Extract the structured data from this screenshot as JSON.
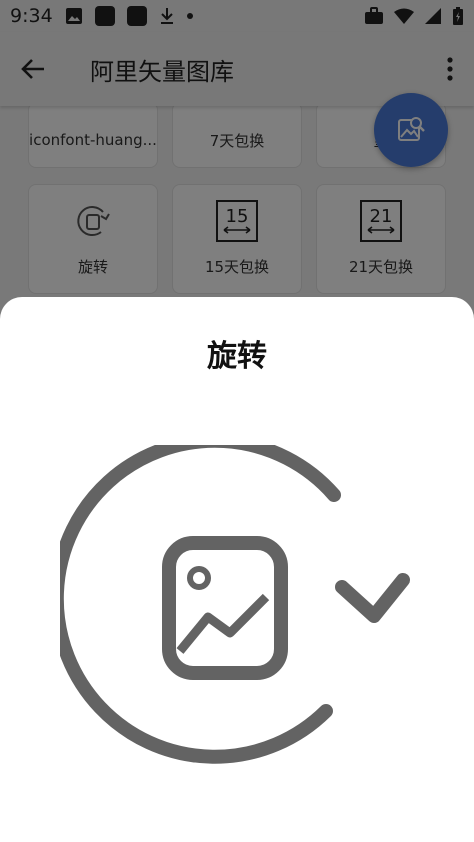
{
  "status_bar": {
    "time": "9:34",
    "icons": [
      "image-icon",
      "app-square-icon",
      "app-square-icon",
      "download-icon",
      "dot-icon",
      "briefcase-icon",
      "wifi-icon",
      "signal-icon",
      "battery-icon"
    ]
  },
  "app_bar": {
    "title": "阿里矢量图库",
    "back_icon": "arrow-back-icon",
    "more_icon": "more-vert-icon"
  },
  "grid": {
    "top_row": [
      {
        "label": "iconfont-huang..."
      },
      {
        "label": "7天包换"
      },
      {
        "label": "皇"
      }
    ],
    "second_row": [
      {
        "label": "旋转",
        "icon": "rotate-image-icon"
      },
      {
        "label": "15天包换",
        "icon": "15-day-exchange-icon",
        "badge": "15"
      },
      {
        "label": "21天包换",
        "icon": "21-day-exchange-icon",
        "badge": "21"
      }
    ]
  },
  "fab": {
    "icon": "image-search-icon",
    "color": "#4b7bd9"
  },
  "sheet": {
    "title": "旋转",
    "icon": "rotate-image-icon",
    "icon_color": "#636363"
  }
}
